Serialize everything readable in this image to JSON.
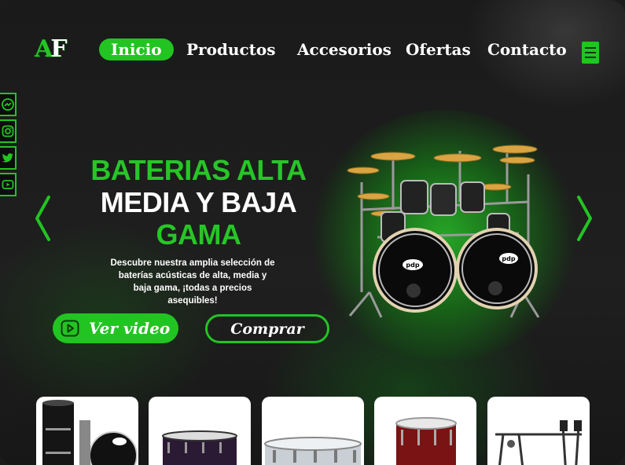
{
  "brand": {
    "logo_letters": [
      "A",
      "F"
    ]
  },
  "nav": {
    "items": [
      {
        "label": "Inicio",
        "active": true
      },
      {
        "label": "Productos",
        "active": false
      },
      {
        "label": "Accesorios",
        "active": false
      },
      {
        "label": "Ofertas",
        "active": false
      },
      {
        "label": "Contacto",
        "active": false
      }
    ],
    "menu_icon": "hamburger-menu-icon"
  },
  "social": [
    "messenger-icon",
    "instagram-icon",
    "twitter-icon",
    "youtube-icon"
  ],
  "hero": {
    "title_line1": "BATERIAS ALTA",
    "title_line2": "MEDIA Y BAJA",
    "title_line3": "GAMA",
    "description": "Descubre nuestra amplia selección de baterías acústicas de alta, media y baja gama, ¡todas a precios asequibles!",
    "video_button": "Ver video",
    "buy_button": "Comprar",
    "drum_brand": "pdp"
  },
  "products": [
    {
      "name": "drum-kit-black"
    },
    {
      "name": "snare-purple"
    },
    {
      "name": "snare-silver"
    },
    {
      "name": "tom-red"
    },
    {
      "name": "double-pedal"
    }
  ],
  "colors": {
    "accent": "#22c422",
    "background": "#1b1b1b",
    "text": "#ffffff"
  }
}
